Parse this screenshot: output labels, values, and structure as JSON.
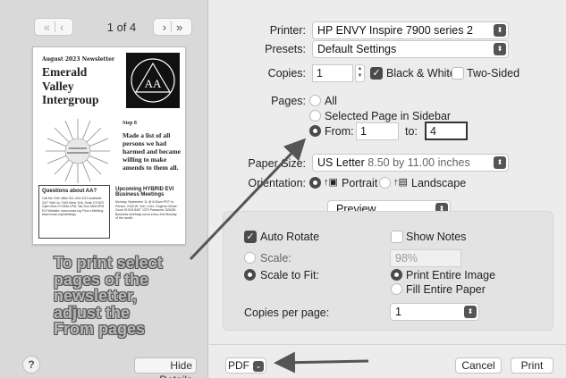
{
  "sidebar": {
    "page_indicator": "1 of 4",
    "prev_label": "‹‹ ‹",
    "next_label": "› ››",
    "help_label": "?",
    "hide_details_label": "Hide Details",
    "overlay_text": "To print select pages of the newsletter, adjust the From pages"
  },
  "newsletter": {
    "kicker": "August 2023 Newsletter",
    "title_lines": [
      "Emerald",
      "Valley",
      "Intergroup"
    ],
    "logo_text": "AA",
    "step_label": "Step 8",
    "step_quote": "Made a list of all persons we had harmed and became willing to make amends to them all.",
    "questions_heading": "Questions about AA?",
    "questions_body": "Call the 24hr office 541-342-4113 Available 24/7 Visit Us: 2160 West 11th, Suite 3 97402 Open Mon-Fri 9AM-1PM, Sat-Sun 9AM-3PM EVI Website: www.eviaa.org Find a Meeting: www.eviaa.org/meetings",
    "hybrid_heading": "Upcoming HYBRID EVI Business Meetings",
    "hybrid_body": "Monday, September 11 @ 6:30pm PDT In-Person: 2160 W. 11th, Unit I, Eugene Online: Zoom ID 819 8497 1370 Password: 826281 Business meetings occur every 2nd Monday of the month"
  },
  "print": {
    "printer_label": "Printer:",
    "printer_value": "HP ENVY Inspire 7900 series 2",
    "presets_label": "Presets:",
    "presets_value": "Default Settings",
    "copies_label": "Copies:",
    "copies_value": "1",
    "bw_label": "Black & White",
    "two_sided_label": "Two-Sided",
    "pages_label": "Pages:",
    "pages_all": "All",
    "pages_selected": "Selected Page in Sidebar",
    "pages_from": "From:",
    "from_value": "1",
    "pages_to": "to:",
    "to_value": "4",
    "paper_size_label": "Paper Size:",
    "paper_size_value": "US Letter",
    "paper_size_dims": "8.50 by 11.00 inches",
    "orientation_label": "Orientation:",
    "portrait_label": "Portrait",
    "landscape_label": "Landscape",
    "section_value": "Preview",
    "auto_rotate_label": "Auto Rotate",
    "show_notes_label": "Show Notes",
    "scale_label": "Scale:",
    "scale_value": "98%",
    "scale_to_fit_label": "Scale to Fit:",
    "print_entire_image": "Print Entire Image",
    "fill_entire_paper": "Fill Entire Paper",
    "copies_per_page_label": "Copies per page:",
    "copies_per_page_value": "1",
    "pdf_label": "PDF",
    "cancel_label": "Cancel",
    "print_label": "Print"
  },
  "state": {
    "black_white_checked": true,
    "two_sided_checked": false,
    "pages_mode": "from",
    "orientation": "portrait",
    "auto_rotate_checked": true,
    "show_notes_checked": false,
    "scale_mode": "scale-to-fit",
    "fit_mode": "print-entire-image"
  },
  "icons": {
    "chevron": "updown-chevron-icon",
    "checkmark": "checkmark-icon",
    "portrait": "portrait-icon",
    "landscape": "landscape-icon"
  },
  "colors": {
    "annotation_arrow": "#555555",
    "overlay_text_fill": "#b8b8b8",
    "focus_ring": "#333333"
  }
}
